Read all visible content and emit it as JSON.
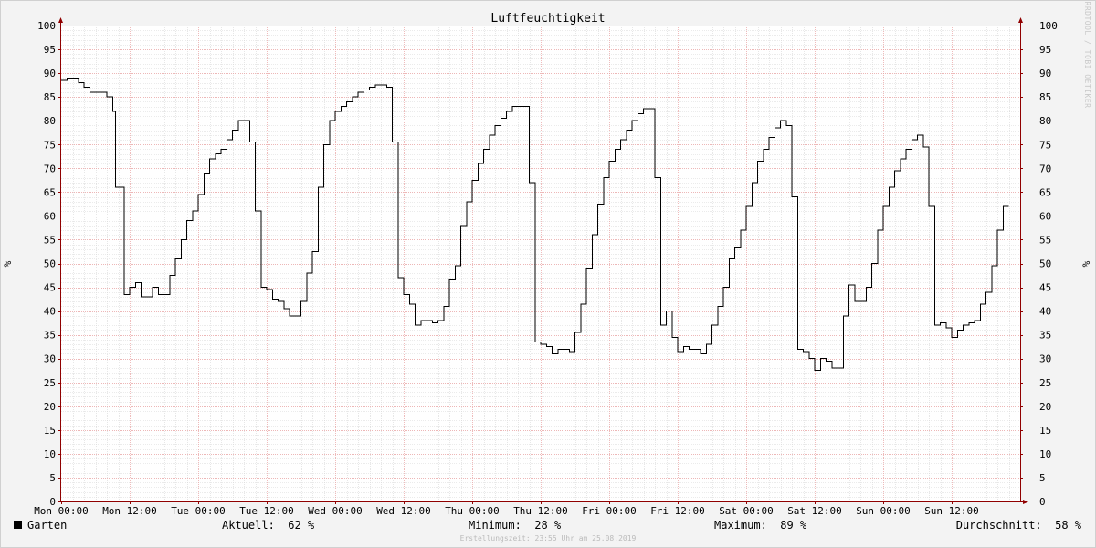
{
  "chart_data": {
    "type": "line",
    "title": "Luftfeuchtigkeit",
    "ylabel": "%",
    "ylim": [
      0,
      100
    ],
    "y_ticks": [
      "0",
      "5",
      "10",
      "15",
      "20",
      "25",
      "30",
      "35",
      "40",
      "45",
      "50",
      "55",
      "60",
      "65",
      "70",
      "75",
      "80",
      "85",
      "90",
      "95",
      "100"
    ],
    "xlim_hours": [
      0,
      168
    ],
    "x_tick_hours": [
      0,
      12,
      24,
      36,
      48,
      60,
      72,
      84,
      96,
      108,
      120,
      132,
      144,
      156
    ],
    "x_ticks": [
      "Mon 00:00",
      "Mon 12:00",
      "Tue 00:00",
      "Tue 12:00",
      "Wed 00:00",
      "Wed 12:00",
      "Thu 00:00",
      "Thu 12:00",
      "Fri 00:00",
      "Fri 12:00",
      "Sat 00:00",
      "Sat 12:00",
      "Sun 00:00",
      "Sun 12:00"
    ],
    "grid": true,
    "series": [
      {
        "name": "Garten",
        "color": "#000000",
        "x_hours": [
          0,
          1,
          3,
          4,
          5,
          6,
          8,
          9,
          9.5,
          10,
          11,
          12,
          13,
          14,
          15,
          16,
          17,
          18,
          19,
          20,
          21,
          22,
          23,
          24,
          25,
          26,
          27,
          28,
          29,
          30,
          31,
          32,
          33,
          34,
          35,
          36,
          37,
          38,
          39,
          40,
          41,
          42,
          43,
          44,
          45,
          46,
          47,
          48,
          49,
          50,
          51,
          52,
          53,
          54,
          55,
          56,
          57,
          58,
          59,
          60,
          61,
          62,
          63,
          64,
          65,
          66,
          67,
          68,
          69,
          70,
          71,
          72,
          73,
          74,
          75,
          76,
          77,
          78,
          79,
          80,
          81,
          82,
          83,
          84,
          85,
          86,
          87,
          88,
          89,
          90,
          91,
          92,
          93,
          94,
          95,
          96,
          97,
          98,
          99,
          100,
          101,
          102,
          103,
          104,
          105,
          106,
          107,
          108,
          109,
          110,
          111,
          112,
          113,
          114,
          115,
          116,
          117,
          118,
          119,
          120,
          121,
          122,
          123,
          124,
          125,
          126,
          127,
          128,
          129,
          130,
          131,
          132,
          133,
          134,
          135,
          136,
          137,
          138,
          139,
          140,
          141,
          142,
          143,
          144,
          145,
          146,
          147,
          148,
          149,
          150,
          151,
          152,
          153,
          154,
          155,
          156,
          157,
          158,
          159,
          160,
          161,
          162,
          163,
          164,
          165,
          166,
          167
        ],
        "values": [
          88.5,
          89,
          88,
          87,
          86,
          86,
          85,
          82,
          66,
          66,
          43.5,
          45,
          46,
          43,
          43,
          45,
          43.5,
          43.5,
          47.5,
          51,
          55,
          59,
          61,
          64.5,
          69,
          72,
          73,
          74,
          76,
          78,
          80,
          80,
          75.5,
          61,
          45,
          44.5,
          42.5,
          42,
          40.5,
          39,
          39,
          42,
          48,
          52.5,
          66,
          75,
          80,
          82,
          83,
          84,
          85,
          86,
          86.5,
          87,
          87.5,
          87.5,
          87,
          75.5,
          47,
          43.5,
          41.5,
          37,
          38,
          38,
          37.5,
          38,
          41,
          46.5,
          49.5,
          58,
          63,
          67.5,
          71,
          74,
          77,
          79,
          80.5,
          82,
          83,
          83,
          83,
          67,
          33.5,
          33,
          32.5,
          31,
          32,
          32,
          31.5,
          35.5,
          41.5,
          49,
          56,
          62.5,
          68,
          71.5,
          74,
          76,
          78,
          80,
          81.5,
          82.5,
          82.5,
          68,
          37,
          40,
          34.5,
          31.5,
          32.5,
          32,
          32,
          31,
          33,
          37,
          41,
          45,
          51,
          53.5,
          57,
          62,
          67,
          71.5,
          74,
          76.5,
          78.5,
          80,
          79,
          64,
          32,
          31.5,
          30,
          27.5,
          30,
          29.5,
          28,
          28,
          39,
          45.5,
          42,
          42,
          45,
          50,
          57,
          62,
          66,
          69.5,
          72,
          74,
          76,
          77,
          74.5,
          62,
          37,
          37.5,
          36.5,
          34.5,
          36,
          37,
          37.5,
          38,
          41.5,
          44,
          49.5,
          57,
          62
        ]
      }
    ],
    "legend": {
      "placement": "bottom-left",
      "label": "Garten",
      "stats": [
        {
          "label": "Aktuell:",
          "value": "62 %"
        },
        {
          "label": "Minimum:",
          "value": "28 %"
        },
        {
          "label": "Maximum:",
          "value": "89 %"
        },
        {
          "label": "Durchschnitt:",
          "value": "58 %"
        }
      ]
    }
  },
  "footer": "Erstellungszeit: 23:55 Uhr am 25.08.2019",
  "watermark": "RRDTOOL / TOBI OETIKER",
  "colors": {
    "background": "#f3f3f3",
    "plot_background": "#ffffff",
    "minor_grid": "#d8d8d8",
    "major_grid": "#e8a0a0",
    "axis": "#900000",
    "line": "#000000"
  }
}
